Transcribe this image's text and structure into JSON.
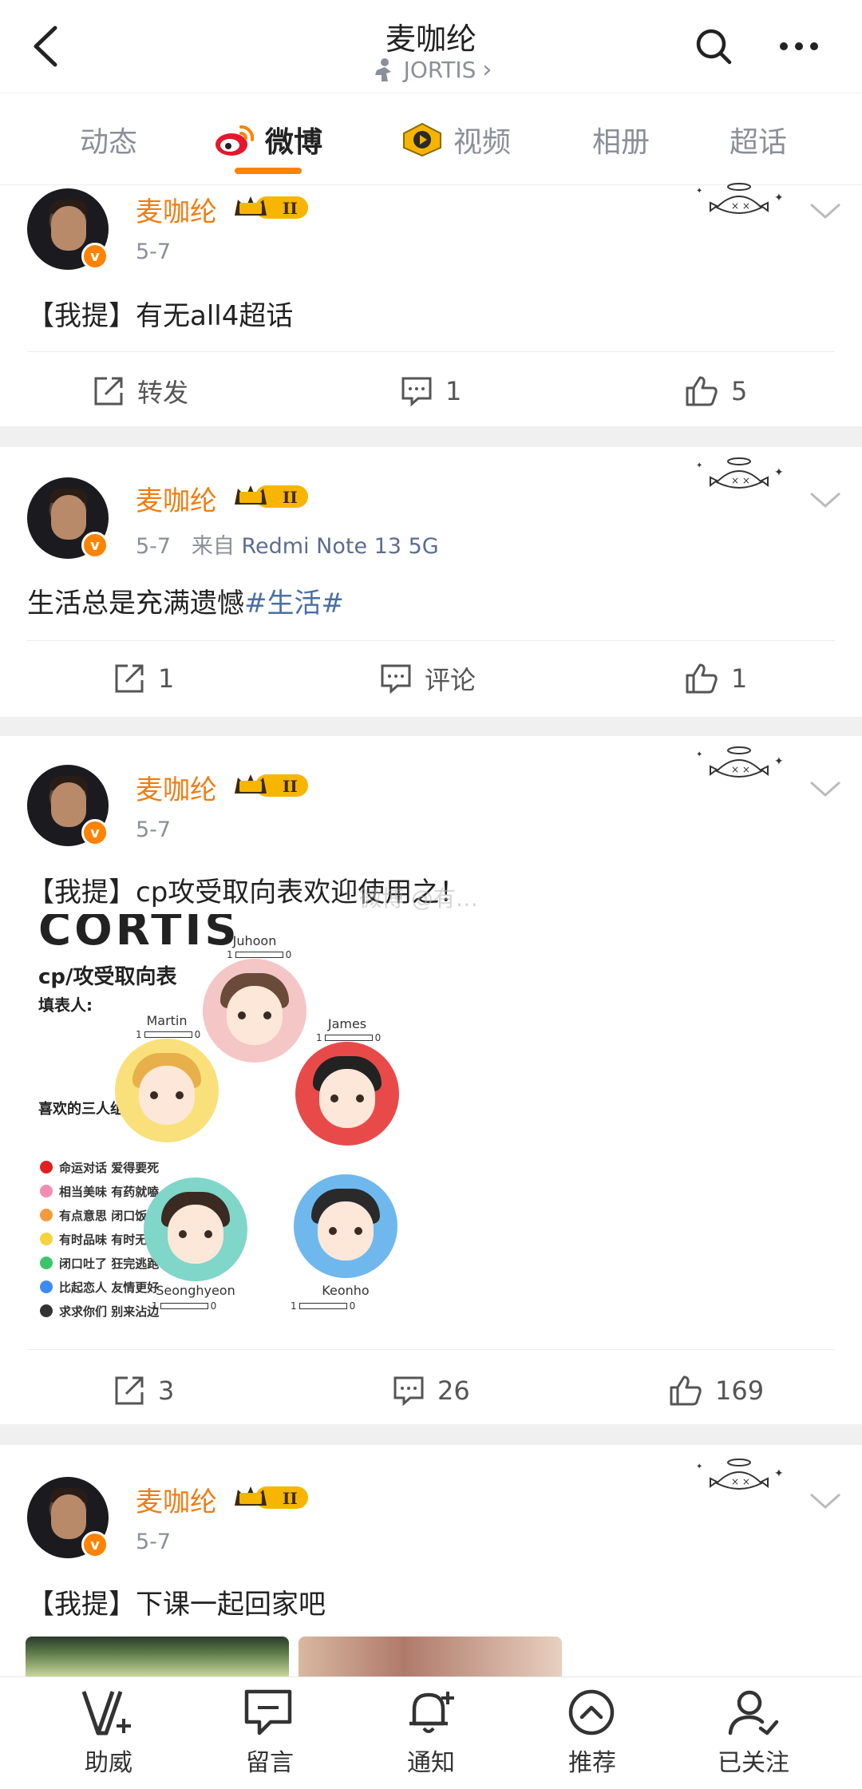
{
  "header": {
    "title": "麦咖纶",
    "subtitle": "JORTIS",
    "subtitle_chevron": "›"
  },
  "tabs": [
    {
      "label": "动态",
      "active": false
    },
    {
      "label": "微博",
      "active": true,
      "icon": "weibo-logo-icon"
    },
    {
      "label": "视频",
      "active": false,
      "icon": "video-icon"
    },
    {
      "label": "相册",
      "active": false
    },
    {
      "label": "超话",
      "active": false
    }
  ],
  "colors": {
    "accent": "#ff8200",
    "username": "#f07c12",
    "hashtag": "#4a6fa5",
    "muted": "#8a8f99"
  },
  "posts": [
    {
      "author": "麦咖纶",
      "badge_label": "II",
      "date": "5-7",
      "text": "【我提】有无all4超话",
      "actions": {
        "repost": "转发",
        "comment": "1",
        "like": "5"
      }
    },
    {
      "author": "麦咖纶",
      "badge_label": "II",
      "date": "5-7",
      "source_prefix": "来自",
      "device": "Redmi Note 13 5G",
      "text": "生活总是充满遗憾",
      "hashtag": "#生活#",
      "actions": {
        "repost": "1",
        "comment": "评论",
        "like": "1"
      }
    },
    {
      "author": "麦咖纶",
      "badge_label": "II",
      "date": "5-7",
      "text": "【我提】cp攻受取向表欢迎使用之！",
      "watermark": "微博 @有…",
      "image": {
        "big_title": "CORTIS",
        "subtitle": "cp/攻受取向表",
        "fill_label": "填表人:",
        "trio_label": "喜欢的三人组:",
        "legend": [
          {
            "color": "#e02020",
            "text": "命运对话 爱得要死"
          },
          {
            "color": "#f28cb1",
            "text": "相当美味 有药就嗑"
          },
          {
            "color": "#f59a3c",
            "text": "有点意思 闭口饭饭"
          },
          {
            "color": "#f5d33c",
            "text": "有时品味 有时无感"
          },
          {
            "color": "#3cc46a",
            "text": "闭口吐了 狂完逃跑"
          },
          {
            "color": "#3c8af5",
            "text": "比起恋人 友情更好"
          },
          {
            "color": "#333333",
            "text": "求求你们 别来沾边"
          }
        ],
        "characters": [
          {
            "name": "Juhoon",
            "bg": "#f5c6c6",
            "hair": "#6a4a38",
            "scale_min": "1",
            "scale_max": "0"
          },
          {
            "name": "Martin",
            "bg": "#f9e07a",
            "hair": "#e8b04a",
            "scale_min": "1",
            "scale_max": "0"
          },
          {
            "name": "James",
            "bg": "#e84a4a",
            "hair": "#222222",
            "scale_min": "1",
            "scale_max": "0"
          },
          {
            "name": "Seonghyeon",
            "bg": "#7fd6c9",
            "hair": "#3a2a22",
            "scale_min": "1",
            "scale_max": "0"
          },
          {
            "name": "Keonho",
            "bg": "#6fb8ee",
            "hair": "#2a2a2a",
            "scale_min": "1",
            "scale_max": "0"
          }
        ]
      },
      "actions": {
        "repost": "3",
        "comment": "26",
        "like": "169"
      }
    },
    {
      "author": "麦咖纶",
      "badge_label": "II",
      "date": "5-7",
      "text": "【我提】下课一起回家吧",
      "actions": {}
    }
  ],
  "bottom_bar": [
    {
      "label": "助威",
      "icon": "cheer-v-icon"
    },
    {
      "label": "留言",
      "icon": "message-icon"
    },
    {
      "label": "通知",
      "icon": "bell-plus-icon"
    },
    {
      "label": "推荐",
      "icon": "recommend-up-icon"
    },
    {
      "label": "已关注",
      "icon": "user-check-icon"
    }
  ]
}
